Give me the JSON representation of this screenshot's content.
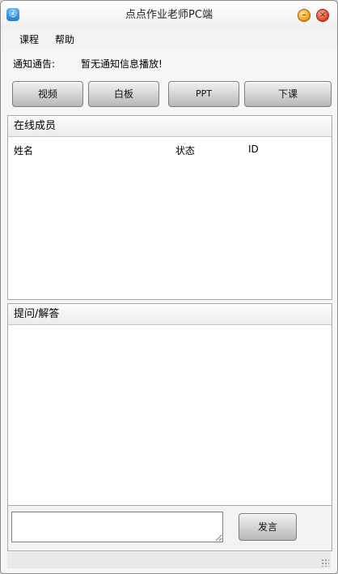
{
  "window": {
    "title": "点点作业老师PC端",
    "icon": "app-logo-icon"
  },
  "menu": {
    "items": [
      "课程",
      "帮助"
    ]
  },
  "notice": {
    "label": "通知通告:",
    "text": "暂无通知信息播放!"
  },
  "toolbar": {
    "video": "视频",
    "whiteboard": "白板",
    "ppt": "PPT",
    "end_class": "下课"
  },
  "members": {
    "title": "在线成员",
    "columns": [
      "姓名",
      "状态",
      "ID"
    ]
  },
  "qa": {
    "title": "提问/解答"
  },
  "composer": {
    "message_value": "",
    "send_label": "发言"
  },
  "colors": {
    "accent_icon": "#2f8fe0",
    "close_button": "#e8482a",
    "minimize_button": "#f3a21b"
  }
}
